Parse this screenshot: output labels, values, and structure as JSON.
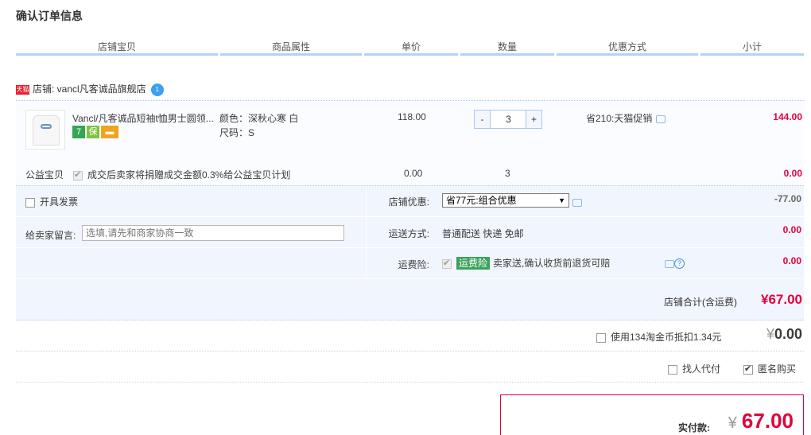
{
  "page_title": "确认订单信息",
  "columns": [
    "店铺宝贝",
    "商品属性",
    "单价",
    "数量",
    "优惠方式",
    "小计"
  ],
  "shop": {
    "badge": "天猫",
    "label": "店铺: vancl凡客诚品旗舰店",
    "ww_badge": "1"
  },
  "item": {
    "title": "Vancl/凡客诚品短袖t恤男士圆领...",
    "service_icons": [
      {
        "name": "seven-day-return-icon",
        "glyph": "7"
      },
      {
        "name": "guarantee-icon",
        "glyph": "保"
      },
      {
        "name": "credit-card-icon",
        "glyph": "▬"
      }
    ],
    "color": "颜色：深秋心寒 白",
    "size": "尺码：S",
    "price": "118.00",
    "quantity": "3",
    "qty_minus": "-",
    "qty_plus": "+",
    "promo": "省210:天猫促销",
    "subtotal": "144.00"
  },
  "charity": {
    "label": "公益宝贝",
    "text": "成交后卖家将捐赠成交金额0.3%给公益宝贝计划",
    "price": "0.00",
    "quantity": "3",
    "subtotal": "0.00"
  },
  "options": {
    "invoice_label": "开具发票",
    "memo_label": "给卖家留言:",
    "memo_placeholder": "选填,请先和商家协商一致",
    "shop_discount_label": "店铺优惠:",
    "shop_discount_value": "省77元:组合优惠",
    "shop_discount_amount": "-77.00",
    "shipping_label": "运送方式:",
    "shipping_value": "普通配送 快递 免邮",
    "shipping_amount": "0.00",
    "insurance_label": "运费险:",
    "insurance_tag": "运费险",
    "insurance_text": "卖家送,确认收货前退货可赔",
    "insurance_amount": "0.00",
    "help_glyph": "?"
  },
  "shop_total": {
    "label": "店铺合计(含运费)",
    "value": "¥67.00"
  },
  "coins": {
    "text": "使用134淘金币抵扣1.34元",
    "yen": "¥",
    "amount": "0.00"
  },
  "extra_options": {
    "proxy_pay": "找人代付",
    "anonymous": "匿名购买"
  },
  "payment": {
    "label": "实付款:",
    "yen": "¥",
    "amount": "67.00"
  }
}
